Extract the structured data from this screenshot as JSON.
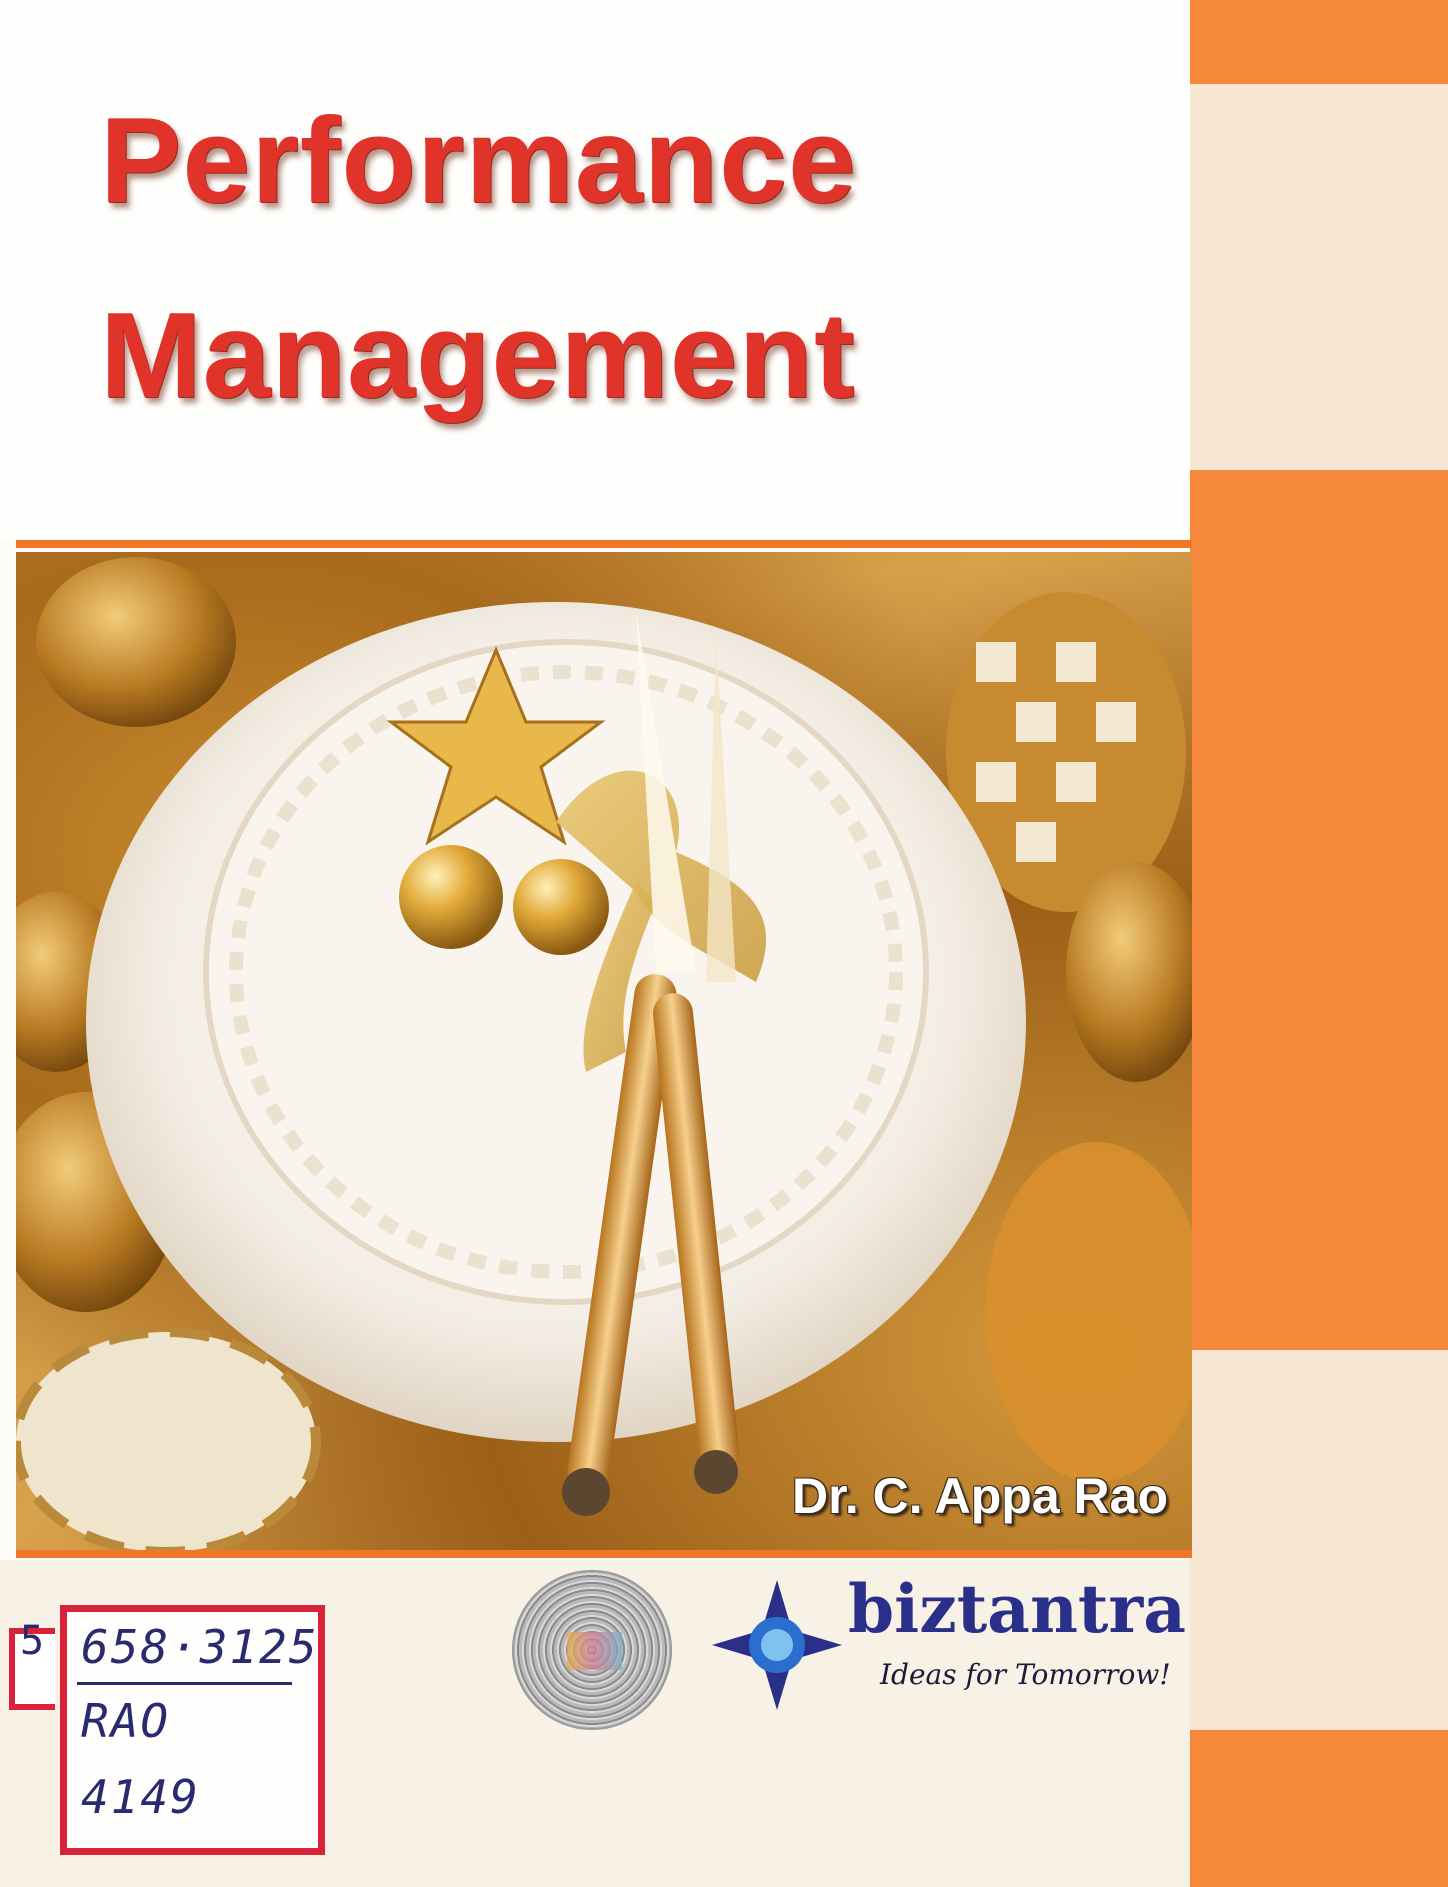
{
  "cover": {
    "title_line1": "Performance",
    "title_line2": "Management",
    "author": "Dr. C. Appa Rao"
  },
  "publisher": {
    "name": "biztantra",
    "tagline": "Ideas for Tomorrow!"
  },
  "library_label": {
    "line1": "658·3125",
    "line2": "RAO",
    "line3": "4149",
    "edge_char": "5"
  },
  "colors": {
    "title_red": "#e0332a",
    "band_orange": "#f5883a",
    "band_cream": "#f7e6d2",
    "brand_blue": "#2a2f8a",
    "label_red": "#d8233b"
  }
}
